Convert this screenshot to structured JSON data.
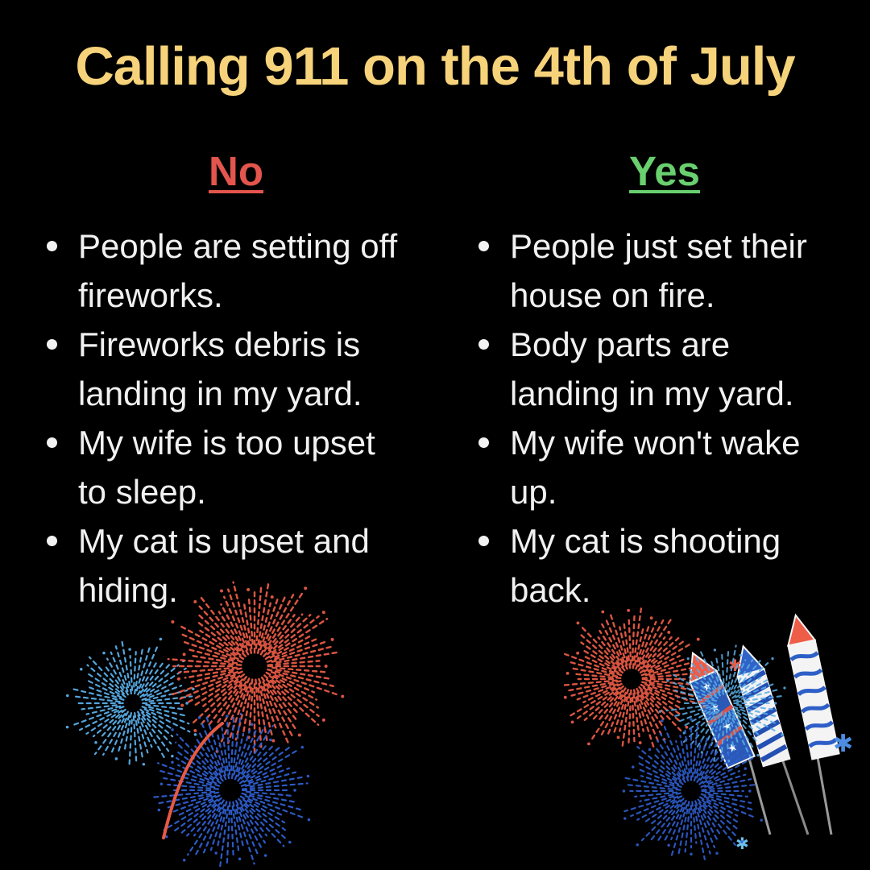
{
  "title": "Calling 911 on the 4th of July",
  "columns": {
    "no": {
      "heading": "No",
      "items": [
        "People are setting off fireworks.",
        "Fireworks debris is landing in my yard.",
        "My wife is too upset to sleep.",
        "My cat is upset and hiding."
      ]
    },
    "yes": {
      "heading": "Yes",
      "items": [
        "People just set their house on fire.",
        "Body parts are landing in my yard.",
        "My wife won't wake up.",
        "My cat is shooting back."
      ]
    }
  },
  "colors": {
    "background": "#000000",
    "title": "#f6d37a",
    "no_heading": "#e3554d",
    "yes_heading": "#69cf6f",
    "body_text": "#f1f1f1",
    "firework_red": "#e65a45",
    "firework_blue": "#2f5fd0",
    "firework_light_blue": "#5aaee8"
  },
  "icons": {
    "left_decoration": "fireworks-bursts",
    "right_decoration": "firework-rockets"
  }
}
